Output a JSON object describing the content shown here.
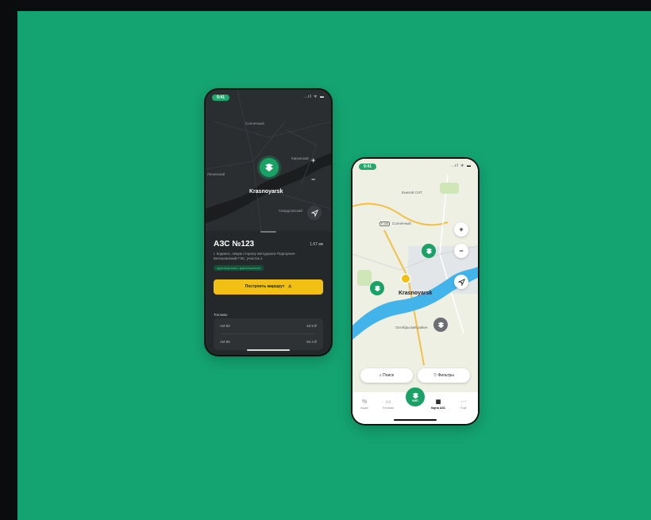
{
  "colors": {
    "background": "#14a472",
    "brand_green": "#1aa266",
    "accent_yellow": "#f2bf14",
    "dark_surface": "#25282b"
  },
  "dark_phone": {
    "status": {
      "time": "9:41",
      "icons": "..ıl ᯤ ▬"
    },
    "map": {
      "labels": [
        "Солнечный",
        "Кировский",
        "Ленинский",
        "Свердловский"
      ],
      "city": "Krasnoyarsk",
      "zoom_in": "+",
      "zoom_out": "−",
      "pin_icon": "fuel-station-icon",
      "nav_icon": "navigation-arrow-icon"
    },
    "sheet": {
      "title": "АЗС №123",
      "distance": "1.67 км",
      "address": "г. Кодинск, левую сторону автодороги Подгорное-Белоусинский ГЭС, участок 1",
      "badge": "круглосуточно, круглосуточно",
      "route_button": "Построить маршрут",
      "route_icon": "warning-icon",
      "fuel_header": "Топливо",
      "fuel": [
        {
          "name": "АИ-92",
          "price": "45.9 ₽"
        },
        {
          "name": "АИ-95",
          "price": "50.4 ₽"
        }
      ]
    }
  },
  "light_phone": {
    "status": {
      "time": "9:41",
      "icons": "..ıl ᯤ ▬"
    },
    "map": {
      "labels": [
        "Енисей СНТ",
        "Солнечный",
        "Октябрьский район"
      ],
      "road_badge": "Р-255",
      "city": "Krasnoyarsk",
      "zoom_in": "+",
      "zoom_out": "−",
      "nav_icon": "navigation-arrow-icon"
    },
    "search_chip": "Поиск",
    "filters_chip": "Фильтры",
    "tabs": [
      {
        "label": "Акции",
        "icon": "percent-icon"
      },
      {
        "label": "Платежи",
        "icon": "wallet-icon"
      },
      {
        "label": "КНП",
        "icon": "fuel-station-icon"
      },
      {
        "label": "Карта АЗС",
        "icon": "map-icon"
      },
      {
        "label": "Ещё",
        "icon": "more-icon"
      }
    ]
  }
}
